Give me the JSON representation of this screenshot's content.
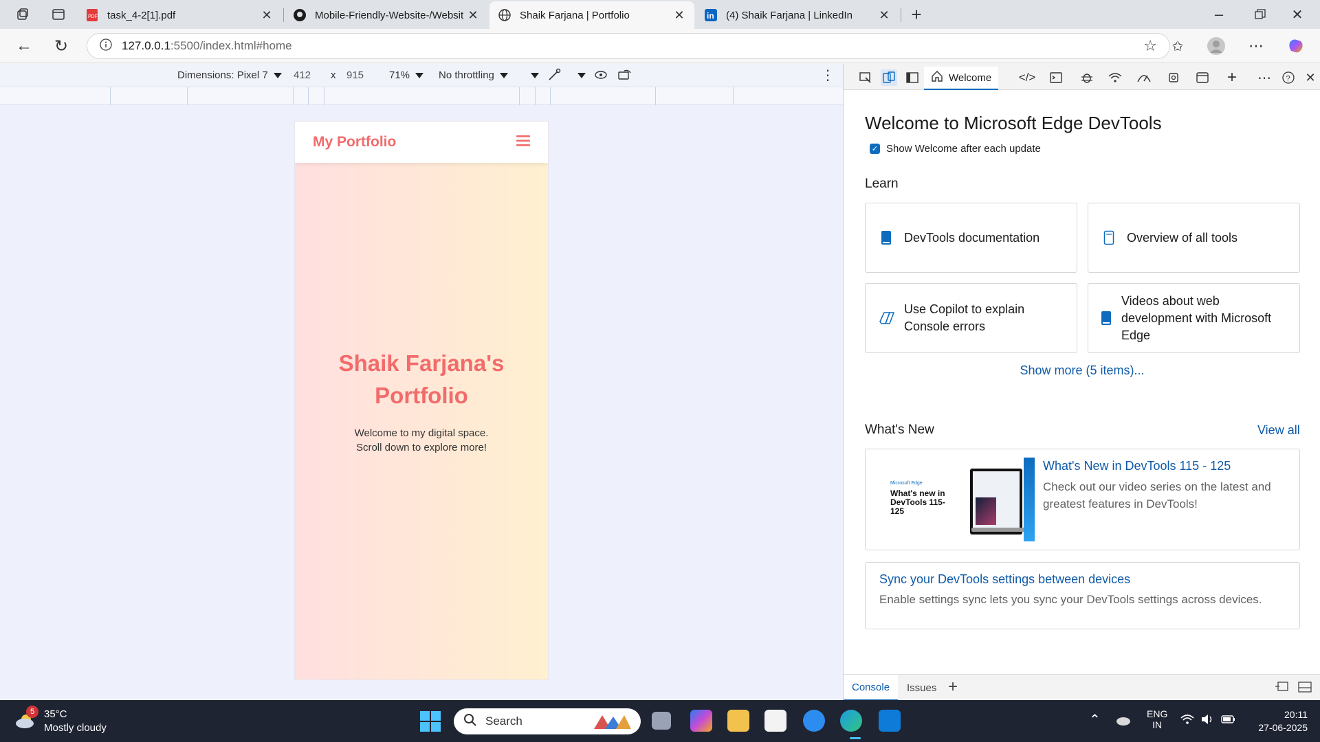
{
  "browser": {
    "tabs": [
      {
        "title": "task_4-2[1].pdf",
        "icon": "pdf-icon"
      },
      {
        "title": "Mobile-Friendly-Website-/Websit",
        "icon": "github-icon"
      },
      {
        "title": "Shaik Farjana | Portfolio",
        "icon": "globe-icon"
      },
      {
        "title": "(4) Shaik Farjana | LinkedIn",
        "icon": "linkedin-icon"
      }
    ],
    "url_host": "127.0.0.1",
    "url_path": ":5500/index.html#home"
  },
  "device_toolbar": {
    "dimensions_label": "Dimensions: Pixel 7",
    "width": "412",
    "times": "x",
    "height": "915",
    "zoom": "71%",
    "throttling": "No throttling"
  },
  "page": {
    "logo": "My Portfolio",
    "hero_title_line1": "Shaik Farjana's",
    "hero_title_line2": "Portfolio",
    "hero_sub_line1": "Welcome to my digital space.",
    "hero_sub_line2": "Scroll down to explore more!",
    "accent_color": "#f26b6b"
  },
  "devtools": {
    "welcome_tab": "Welcome",
    "title": "Welcome to Microsoft Edge DevTools",
    "show_welcome": "Show Welcome after each update",
    "learn_heading": "Learn",
    "learn_cards": [
      "DevTools documentation",
      "Overview of all tools",
      "Use Copilot to explain Console errors",
      "Videos about web development with Microsoft Edge"
    ],
    "show_more": "Show more (5 items)...",
    "whats_new_heading": "What's New",
    "view_all": "View all",
    "news1_title": "What's New in DevTools 115 - 125",
    "news1_desc": "Check out our video series on the latest and greatest features in DevTools!",
    "news1_thumb_brand": "Microsoft Edge",
    "news1_thumb_text": "What's new in DevTools 115-125",
    "news2_title": "Sync your DevTools settings between devices",
    "news2_desc": "Enable settings sync lets you sync your DevTools settings across devices.",
    "drawer_tabs": [
      "Console",
      "Issues"
    ]
  },
  "taskbar": {
    "weather_temp": "35°C",
    "weather_desc": "Mostly cloudy",
    "weather_badge": "5",
    "search_placeholder": "Search",
    "lang1": "ENG",
    "lang2": "IN",
    "time": "20:11",
    "date": "27-06-2025"
  }
}
